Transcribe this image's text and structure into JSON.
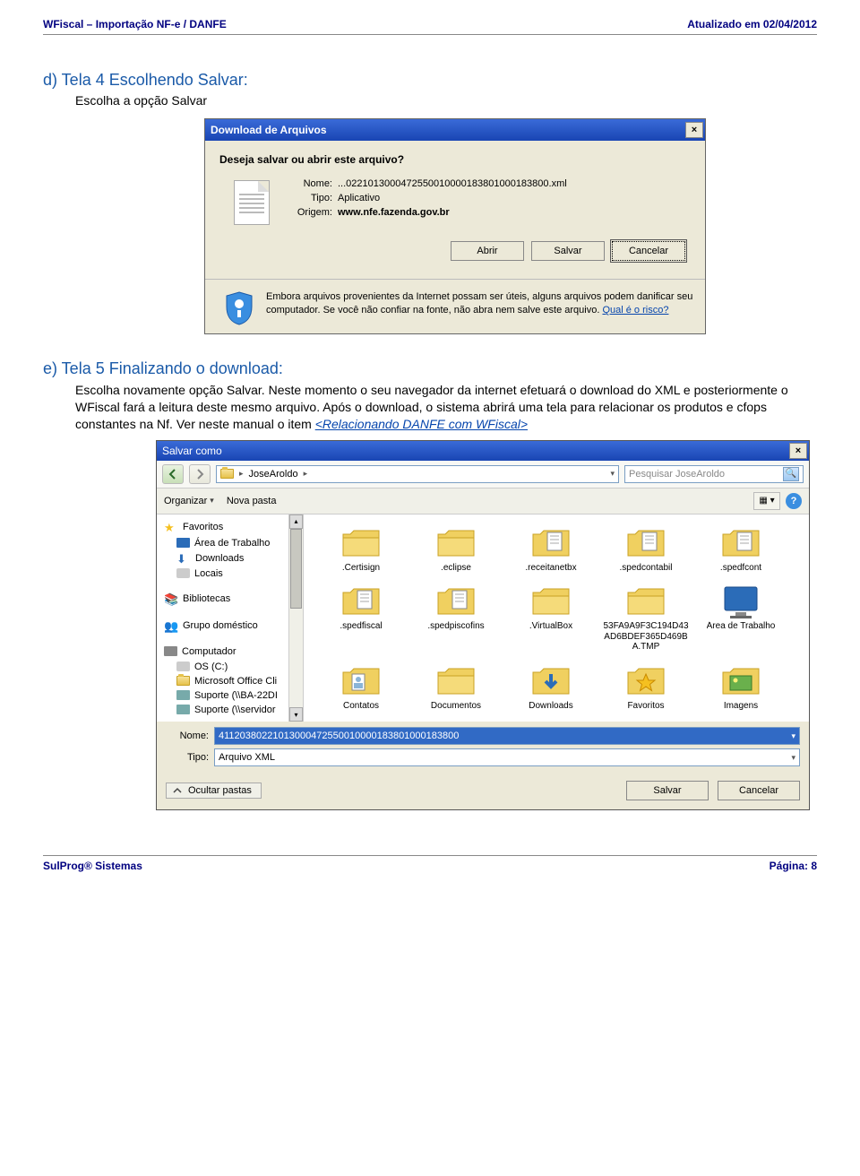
{
  "header": {
    "left": "WFiscal – Importação NF-e / DANFE",
    "right": "Atualizado em 02/04/2012"
  },
  "sectionD": {
    "title": "d)  Tela 4 Escolhendo Salvar:",
    "sub": "Escolha a opção Salvar"
  },
  "dialog1": {
    "title": "Download de Arquivos",
    "prompt": "Deseja salvar ou abrir este arquivo?",
    "name_label": "Nome:",
    "name_value": "...02210130004725500100001838010001838​00.xml",
    "type_label": "Tipo:",
    "type_value": "Aplicativo",
    "origin_label": "Origem:",
    "origin_value": "www.nfe.fazenda.gov.br",
    "buttons": {
      "open": "Abrir",
      "save": "Salvar",
      "cancel": "Cancelar"
    },
    "warning_text": "Embora arquivos provenientes da Internet possam ser úteis, alguns arquivos podem danificar seu computador. Se você não confiar na fonte, não abra nem salve este arquivo. ",
    "warning_link": "Qual é o risco?"
  },
  "sectionE": {
    "title": "e)  Tela 5 Finalizando o download:",
    "body": "Escolha novamente opção Salvar. Neste momento o seu navegador da internet efetuará o download do XML e posteriormente o WFiscal fará a leitura deste mesmo arquivo. Após o download, o sistema abrirá uma tela para relacionar os produtos e cfops constantes na Nf. Ver neste manual o item ",
    "link": "<Relacionando DANFE com WFiscal>"
  },
  "saveas": {
    "title": "Salvar como",
    "breadcrumb": "JoseAroldo",
    "search_placeholder": "Pesquisar JoseAroldo",
    "toolbar": {
      "organize": "Organizar",
      "newfolder": "Nova pasta"
    },
    "tree": {
      "favorites": "Favoritos",
      "items1": [
        "Área de Trabalho",
        "Downloads",
        "Locais"
      ],
      "libraries": "Bibliotecas",
      "homegroup": "Grupo doméstico",
      "computer": "Computador",
      "items2": [
        "OS (C:)",
        "Microsoft Office Cli",
        "Suporte (\\\\BA-22DI",
        "Suporte (\\\\servidor"
      ]
    },
    "files_row1": [
      {
        "label": ".Certisign",
        "type": "folder"
      },
      {
        "label": ".eclipse",
        "type": "folder"
      },
      {
        "label": ".receitanetbx",
        "type": "folder-doc"
      },
      {
        "label": ".spedcontabil",
        "type": "folder-doc"
      },
      {
        "label": ".spedfcont",
        "type": "folder-doc"
      }
    ],
    "files_row2": [
      {
        "label": ".spedfiscal",
        "type": "folder-doc"
      },
      {
        "label": ".spedpiscofins",
        "type": "folder-doc"
      },
      {
        "label": ".VirtualBox",
        "type": "folder"
      },
      {
        "label": "53FA9A9F3C194D43AD6BDEF365D469BA.TMP",
        "type": "folder"
      },
      {
        "label": "Área de Trabalho",
        "type": "desktop"
      }
    ],
    "files_row3": [
      {
        "label": "Contatos",
        "type": "contacts"
      },
      {
        "label": "Documentos",
        "type": "folder"
      },
      {
        "label": "Downloads",
        "type": "downloads"
      },
      {
        "label": "Favoritos",
        "type": "favorites"
      },
      {
        "label": "Imagens",
        "type": "images"
      }
    ],
    "fields": {
      "name_label": "Nome:",
      "name_value": "4112038022101300047255001000018380​1000183800",
      "type_label": "Tipo:",
      "type_value": "Arquivo XML"
    },
    "hide_folders": "Ocultar pastas",
    "save": "Salvar",
    "cancel": "Cancelar"
  },
  "footer": {
    "left": "SulProg® Sistemas",
    "right": "Página: 8"
  }
}
